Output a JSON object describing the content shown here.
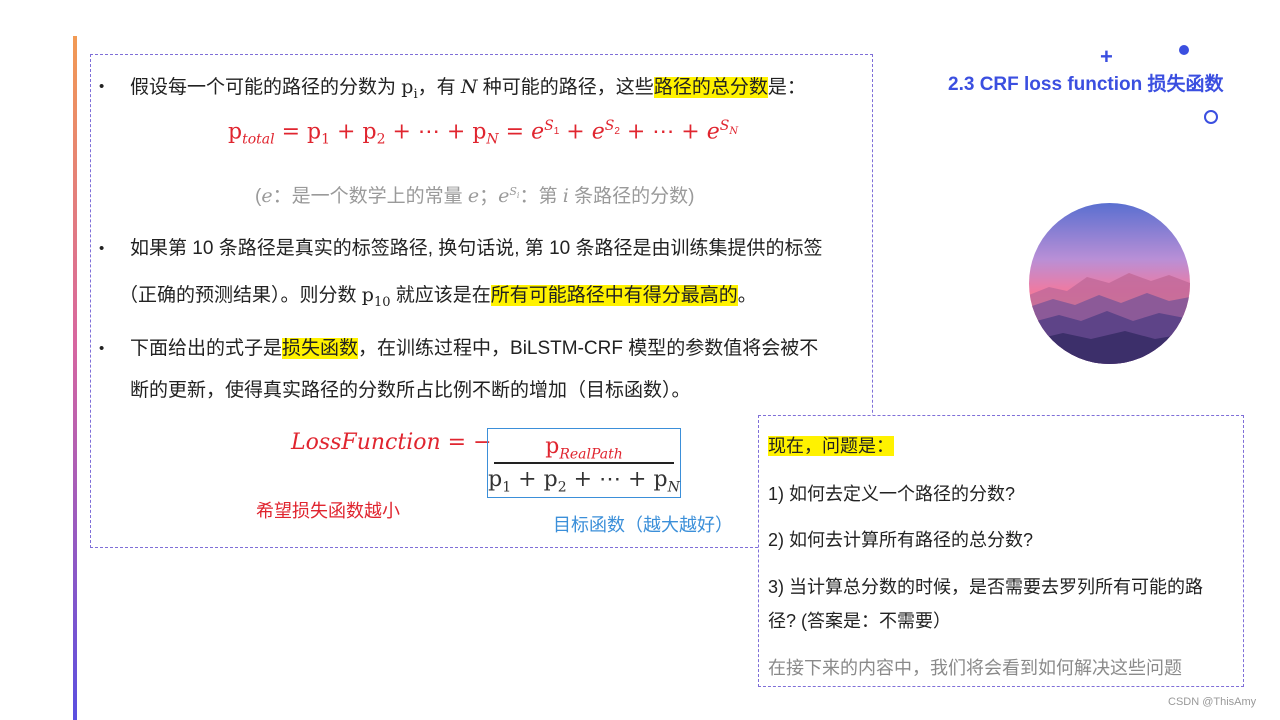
{
  "title": "2.3 CRF loss function 损失函数",
  "bullet_symbol": "•",
  "bullets": [
    {
      "text_a": "假设每一个可能的路径的分数为 ",
      "var_p": "p",
      "sub_i": "i",
      "text_b": "，有 ",
      "var_N": "N",
      "text_c": " 种可能的路径，这些",
      "highlight": "路径的总分数",
      "text_d": "是："
    },
    {
      "line1": "如果第 10 条路径是真实的标签路径, 换句话说, 第 10 条路径是由训练集提供的标签",
      "line2_a": "（正确的预测结果）。则分数 ",
      "var_p": "p",
      "sub": "10",
      "line2_b": " 就应该是在",
      "highlight": "所有可能路径中有得分最高的",
      "line2_c": "。"
    },
    {
      "line1_a": "下面给出的式子是",
      "highlight": "损失函数",
      "line1_b": "，在训练过程中，BiLSTM-CRF  模型的参数值将会被不",
      "line2": "断的更新，使得真实路径的分数所占比例不断的增加（目标函数）。"
    }
  ],
  "formula_total": {
    "p": "p",
    "sub_total": "total",
    "eq": " = ",
    "p1": "p",
    "s1": "1",
    "plus": " + ",
    "p2": "p",
    "s2": "2",
    "dots": " + ⋯ + ",
    "pN": "p",
    "sN": "N",
    "eq2": " = ",
    "e": "e",
    "S": "S",
    "i1": "1",
    "i2": "2",
    "iN": "N"
  },
  "note_e": {
    "open": "(",
    "e": "e",
    "text1": "：是一个数学上的常量 ",
    "e2": "e",
    "text2": "；",
    "e3": "e",
    "sup_S": "S",
    "sup_i": "i",
    "text3": "：第 ",
    "i": "i",
    "text4": " 条路径的分数)"
  },
  "loss": {
    "name": "LossFunction",
    "eq": " = −",
    "num_p": "p",
    "num_sub": "RealPath",
    "den_p1": "p",
    "den_s1": "1",
    "den_plus": " + ",
    "den_p2": "p",
    "den_s2": "2",
    "den_dots": " + ⋯ + ",
    "den_pN": "p",
    "den_sN": "N"
  },
  "note_red": "希望损失函数越小",
  "note_blue": "目标函数（越大越好）",
  "side": {
    "heading": "现在，问题是：",
    "q1": "1) 如何去定义一个路径的分数?",
    "q2": "2) 如何去计算所有路径的总分数?",
    "q3_line1": "3)  当计算总分数的时候，是否需要去罗列所有可能的路",
    "q3_line2": "径?  (答案是：不需要）",
    "footer": "在接下来的内容中，我们将会看到如何解决这些问题"
  },
  "watermark": "CSDN @ThisAmy",
  "colors": {
    "accent_blue": "#3b4fe0",
    "formula_red": "#e0252f",
    "highlight_yellow": "#fff200",
    "target_blue": "#3b8fd9"
  }
}
